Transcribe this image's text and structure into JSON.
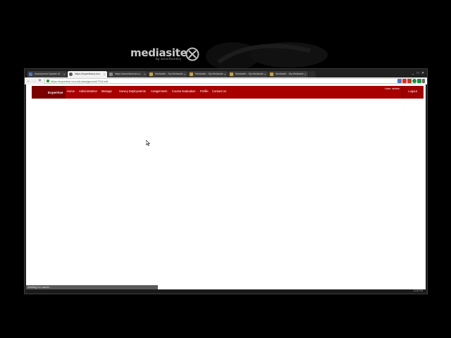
{
  "watermark": {
    "brand_word": "mediasite",
    "byline": "by sonicfoundry"
  },
  "browser": {
    "tabs": [
      {
        "label": "Assessment Update M",
        "active": false
      },
      {
        "label": "https://expertlocus.ecu",
        "active": true
      },
      {
        "label": "https://www.flashvid.co",
        "active": false
      },
      {
        "label": "Mediasite - My Mediasite",
        "active": false
      },
      {
        "label": "Mediasite - My Mediasite",
        "active": false
      },
      {
        "label": "Mediasite - My Mediasite",
        "active": false
      },
      {
        "label": "Mediasite - My Mediasite",
        "active": false
      }
    ],
    "url_host": "https://expertise.ecu.edu",
    "url_path": "/assignment/7911edit",
    "window_controls": [
      "_",
      "□",
      "✕"
    ]
  },
  "site": {
    "brand": "Expertise",
    "nav": [
      "Home",
      "Administration",
      "Manage",
      "Survey Deployments",
      "Assignments",
      "Course Evaluation",
      "Profile",
      "Contact Us"
    ],
    "user_label": "User: admin",
    "logout_label": "Logout"
  },
  "status": {
    "text": "Waiting for cache...",
    "clock": "12:00 PM"
  },
  "colors": {
    "nav_red": "#a80000",
    "brand_dark_red": "#7a0000",
    "page_bg": "#000000"
  }
}
